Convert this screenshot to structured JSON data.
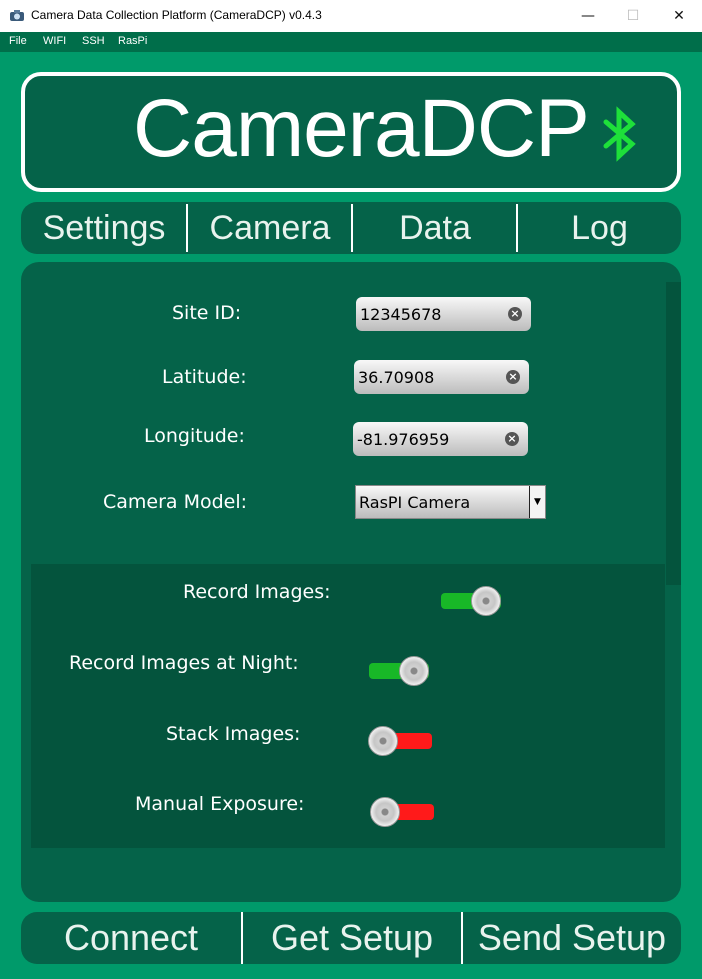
{
  "window": {
    "title": "Camera Data Collection Platform (CameraDCP) v0.4.3",
    "minimize": "—",
    "maximize": "☐",
    "close": "✕"
  },
  "menu": {
    "items": [
      "File",
      "WIFI",
      "SSH",
      "RasPi"
    ]
  },
  "banner": {
    "title": "CameraDCP",
    "status_icon": "bluetooth-icon",
    "status_color": "#1ee03a"
  },
  "tabs": [
    "Settings",
    "Camera",
    "Data",
    "Log"
  ],
  "settings": {
    "site_id": {
      "label": "Site ID:",
      "value": "12345678"
    },
    "latitude": {
      "label": "Latitude:",
      "value": "36.70908"
    },
    "longitude": {
      "label": "Longitude:",
      "value": "-81.976959"
    },
    "camera_model": {
      "label": "Camera Model:",
      "value": "RasPI Camera",
      "arrow": "▼"
    },
    "toggles": [
      {
        "label": "Record Images:",
        "state": "on"
      },
      {
        "label": "Record Images at Night:",
        "state": "on"
      },
      {
        "label": "Stack Images:",
        "state": "off"
      },
      {
        "label": "Manual Exposure:",
        "state": "off"
      }
    ]
  },
  "actions": [
    "Connect",
    "Get Setup",
    "Send Setup"
  ],
  "colors": {
    "app_bg": "#009a6a",
    "panel_bg": "#056349",
    "toggle_on": "#18b827",
    "toggle_off": "#ff1a1a"
  }
}
